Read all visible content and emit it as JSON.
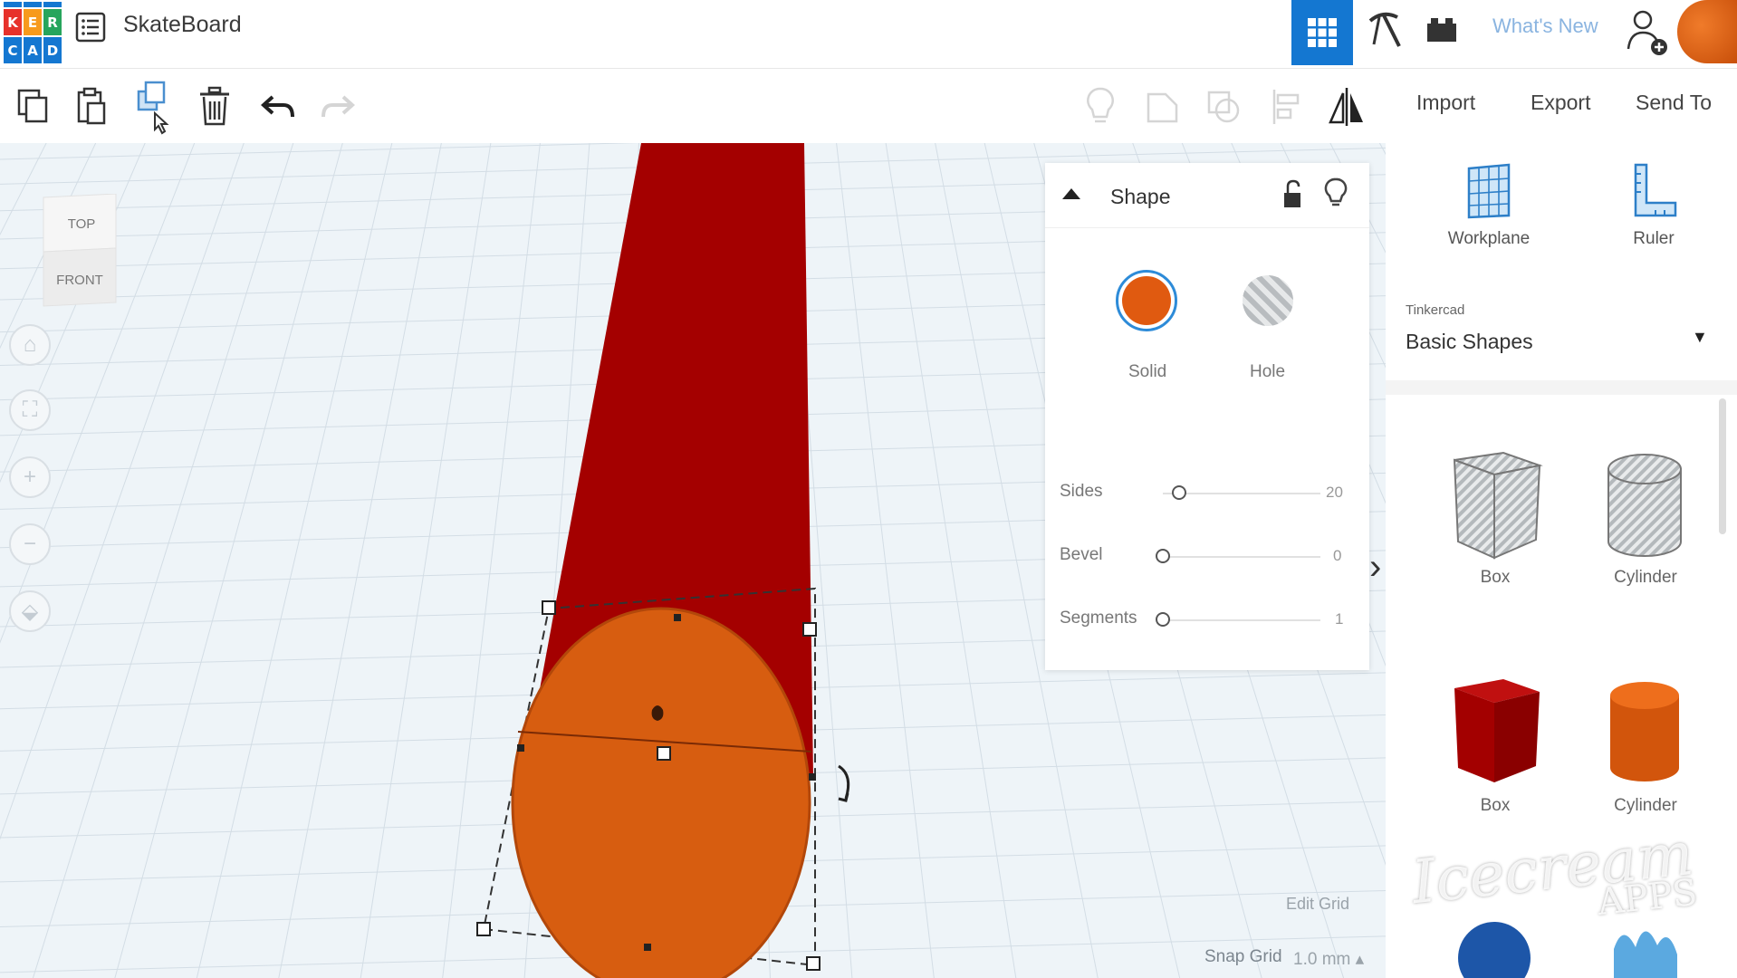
{
  "header": {
    "logo_letters": [
      "K",
      "E",
      "R",
      "C",
      "A",
      "D"
    ],
    "title": "SkateBoard",
    "whats_new": "What's New"
  },
  "toolbar": {
    "import_label": "Import",
    "export_label": "Export",
    "send_to_label": "Send To"
  },
  "viewcube": {
    "top": "TOP",
    "front": "FRONT"
  },
  "view_controls": [
    "home-icon",
    "fit-icon",
    "zoom-in-icon",
    "zoom-out-icon",
    "perspective-icon"
  ],
  "inspector": {
    "title": "Shape",
    "solid_label": "Solid",
    "hole_label": "Hole",
    "params": [
      {
        "label": "Sides",
        "value": "20"
      },
      {
        "label": "Bevel",
        "value": "0"
      },
      {
        "label": "Segments",
        "value": "1"
      }
    ]
  },
  "workplane": {
    "edit_grid": "Edit Grid",
    "snap_grid_label": "Snap Grid",
    "snap_grid_value": "1.0 mm"
  },
  "right_panel": {
    "workplane_label": "Workplane",
    "ruler_label": "Ruler",
    "library_source": "Tinkercad",
    "library_name": "Basic Shapes",
    "shapes": [
      {
        "label": "Box",
        "kind": "box-hole"
      },
      {
        "label": "Cylinder",
        "kind": "cylinder-hole"
      },
      {
        "label": "Box",
        "kind": "box-solid"
      },
      {
        "label": "Cylinder",
        "kind": "cylinder-solid"
      }
    ]
  },
  "watermark": {
    "brand": "Icecream",
    "sub": "APPS"
  },
  "colors": {
    "accent": "#1477d1",
    "solid_orange": "#e05a10",
    "red_board": "#a40000",
    "logo_tiles": [
      "#e7312a",
      "#f79a1c",
      "#26a55c",
      "#1477d1",
      "#1477d1",
      "#1477d1"
    ]
  }
}
